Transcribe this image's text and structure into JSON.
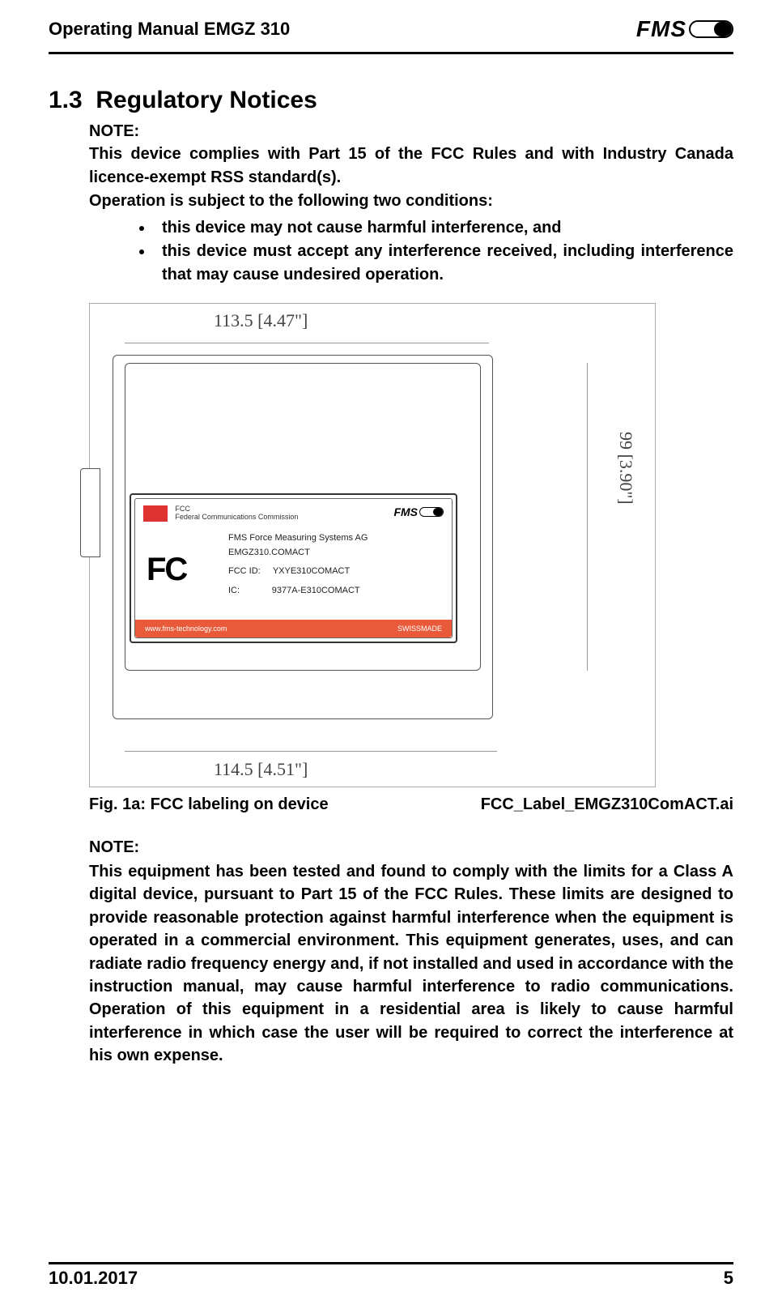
{
  "header": {
    "title": "Operating Manual EMGZ 310",
    "logo": "FMS"
  },
  "section": {
    "number": "1.3",
    "title": "Regulatory Notices"
  },
  "note1": {
    "label": "NOTE:",
    "text1": "This device complies with Part 15 of the FCC Rules and with Industry Canada licence-exempt RSS standard(s).",
    "text2": "Operation is subject to the following two conditions:",
    "bullets": [
      "this device may not cause harmful interference, and",
      "this device must accept any interference received, including interference that may cause undesired operation."
    ]
  },
  "figure": {
    "dim_top": "113.5 [4.47\"]",
    "dim_bottom": "114.5 [4.51\"]",
    "dim_right": "99 [3.90\"]",
    "label": {
      "fcc_small_line1": "FCC",
      "fcc_small_line2": "Federal Communications Commission",
      "fms_mini": "FMS",
      "company": "FMS Force Measuring Systems AG",
      "model": "EMGZ310.COMACT",
      "fcc_id_label": "FCC ID:",
      "fcc_id_value": "YXYE310COMACT",
      "ic_label": "IC:",
      "ic_value": "9377A-E310COMACT",
      "url": "www.fms-technology.com",
      "swissmade": "SWISSMADE",
      "big_fcc": "FC"
    },
    "caption_fig": "Fig. 1a:",
    "caption_text": " FCC labeling on device",
    "caption_file": "FCC_Label_EMGZ310ComACT.ai"
  },
  "note2": {
    "label": "NOTE:",
    "text": "This equipment has been tested and found to comply with the limits for a Class A digital device, pursuant to Part 15 of the FCC Rules. These limits are designed to provide reasonable protection against harmful interference when the equipment is operated in a commercial environment. This equipment generates, uses, and can radiate radio frequency energy and, if not installed and used in accordance with the instruction manual, may cause harmful interference to radio communications. Operation of this equipment in a residential area is likely to cause harmful interference in which case the user will be required to correct the interference at his own expense."
  },
  "footer": {
    "date": "10.01.2017",
    "page": "5"
  }
}
